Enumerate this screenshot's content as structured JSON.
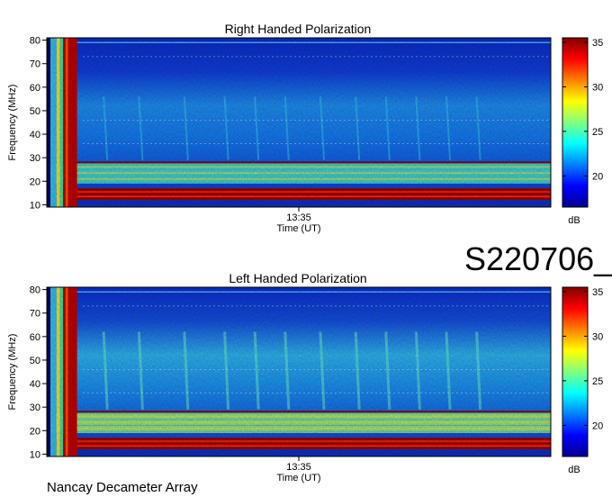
{
  "sheet_id": "S220706_",
  "footer": "Nancay Decameter Array",
  "colormap_stops": [
    "#00008f",
    "#0000ff",
    "#0080ff",
    "#00ffff",
    "#80ff80",
    "#ffff00",
    "#ff8000",
    "#ff0000",
    "#800000"
  ],
  "chart_data": [
    {
      "type": "heatmap",
      "title": "Right Handed Polarization",
      "xlabel": "Time (UT)",
      "ylabel": "Frequency (MHz)",
      "x_ticks": [
        "13:35"
      ],
      "y_ticks": [
        10,
        20,
        30,
        40,
        50,
        60,
        70,
        80
      ],
      "ylim": [
        9,
        81
      ],
      "colorbar": {
        "label": "dB",
        "ticks": [
          20,
          25,
          30,
          35
        ],
        "range": [
          16.5,
          35.5
        ]
      },
      "features": {
        "strong_band_mhz": [
          12,
          17
        ],
        "secondary_band_mhz": [
          19,
          28
        ],
        "burst_columns_fraction": [
          0.0,
          0.06
        ],
        "background_level": "low"
      }
    },
    {
      "type": "heatmap",
      "title": "Left Handed Polarization",
      "xlabel": "Time (UT)",
      "ylabel": "Frequency (MHz)",
      "x_ticks": [
        "13:35"
      ],
      "y_ticks": [
        10,
        20,
        30,
        40,
        50,
        60,
        70,
        80
      ],
      "ylim": [
        9,
        81
      ],
      "colorbar": {
        "label": "dB",
        "ticks": [
          20,
          25,
          30,
          35
        ],
        "range": [
          16.5,
          35.5
        ]
      },
      "features": {
        "strong_band_mhz": [
          12,
          17
        ],
        "secondary_band_mhz": [
          19,
          28
        ],
        "burst_columns_fraction": [
          0.0,
          0.06
        ],
        "background_level": "medium"
      }
    }
  ]
}
